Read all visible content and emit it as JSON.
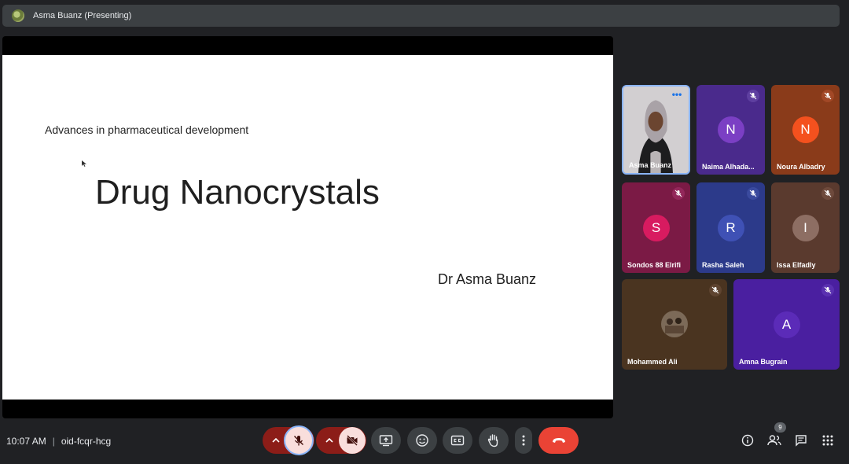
{
  "topbar": {
    "presenter": "Asma Buanz (Presenting)"
  },
  "slide": {
    "subtitle": "Advances in pharmaceutical development",
    "title": "Drug Nanocrystals",
    "author": "Dr Asma Buanz"
  },
  "participants": [
    {
      "name": "Asma Buanz",
      "initial": "",
      "color": "#c9c5c8"
    },
    {
      "name": "Naima Alhada...",
      "initial": "N",
      "color": "#4a2a8c",
      "avatar": "#7b3fc4"
    },
    {
      "name": "Noura Albadry",
      "initial": "N",
      "color": "#8a3b1a",
      "avatar": "#f4511e"
    },
    {
      "name": "Sondos 88 Elrifi",
      "initial": "S",
      "color": "#7b1a45",
      "avatar": "#d81b60"
    },
    {
      "name": "Rasha Saleh",
      "initial": "R",
      "color": "#2c3a8a",
      "avatar": "#3f51b5"
    },
    {
      "name": "Issa Elfadly",
      "initial": "I",
      "color": "#5a3a2e",
      "avatar": "#8d6e63"
    },
    {
      "name": "Mohammed Ali",
      "initial": "",
      "color": "#4a3420"
    },
    {
      "name": "Amna Bugrain",
      "initial": "A",
      "color": "#4a1fa0",
      "avatar": "#5b2bb8"
    }
  ],
  "bottom": {
    "time": "10:07 AM",
    "meeting_code": "oid-fcqr-hcg",
    "people_count": "9"
  },
  "colors": {
    "end_call": "#ea4335",
    "mic_off_bg": "#f9dedc",
    "accent": "#8ab4f8"
  }
}
